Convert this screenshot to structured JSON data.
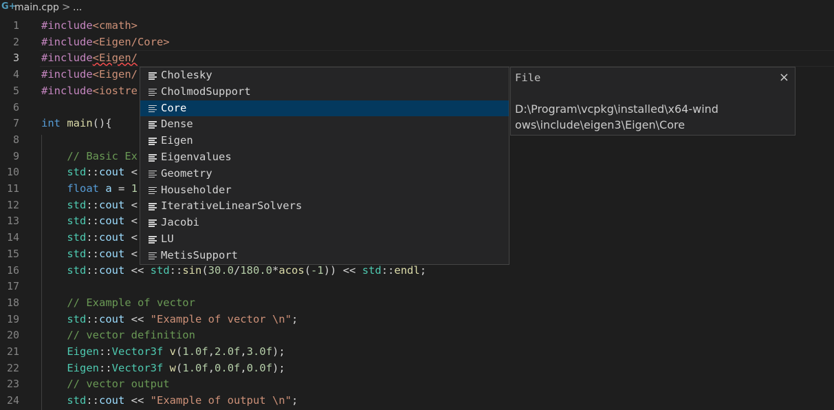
{
  "breadcrumb": {
    "file_icon": "G+",
    "file": "main.cpp",
    "separator": ">",
    "ellipsis": "..."
  },
  "editor": {
    "current_line": 3,
    "lines": [
      {
        "n": "1",
        "tokens": [
          [
            "dir",
            "#include"
          ],
          [
            "str",
            "<cmath>"
          ]
        ]
      },
      {
        "n": "2",
        "tokens": [
          [
            "dir",
            "#include"
          ],
          [
            "str",
            "<Eigen/Core>"
          ]
        ]
      },
      {
        "n": "3",
        "tokens": [
          [
            "dir",
            "#include"
          ],
          [
            "str",
            "<Eigen/"
          ]
        ]
      },
      {
        "n": "4",
        "tokens": [
          [
            "dir",
            "#include"
          ],
          [
            "str",
            "<Eigen/"
          ]
        ]
      },
      {
        "n": "5",
        "tokens": [
          [
            "dir",
            "#include"
          ],
          [
            "str",
            "<iostre"
          ]
        ]
      },
      {
        "n": "6",
        "tokens": []
      },
      {
        "n": "7",
        "tokens": [
          [
            "kw",
            "int"
          ],
          [
            "op",
            " "
          ],
          [
            "fn",
            "main"
          ],
          [
            "op",
            "(){"
          ]
        ]
      },
      {
        "n": "8",
        "tokens": []
      },
      {
        "n": "9",
        "tokens": [
          [
            "op",
            "    "
          ],
          [
            "com",
            "// Basic Ex"
          ]
        ]
      },
      {
        "n": "10",
        "tokens": [
          [
            "op",
            "    "
          ],
          [
            "ns",
            "std"
          ],
          [
            "op",
            "::"
          ],
          [
            "var",
            "cout"
          ],
          [
            "op",
            " <"
          ]
        ]
      },
      {
        "n": "11",
        "tokens": [
          [
            "op",
            "    "
          ],
          [
            "kw",
            "float"
          ],
          [
            "op",
            " "
          ],
          [
            "var",
            "a"
          ],
          [
            "op",
            " = "
          ],
          [
            "num",
            "1"
          ]
        ]
      },
      {
        "n": "12",
        "tokens": [
          [
            "op",
            "    "
          ],
          [
            "ns",
            "std"
          ],
          [
            "op",
            "::"
          ],
          [
            "var",
            "cout"
          ],
          [
            "op",
            " <"
          ]
        ]
      },
      {
        "n": "13",
        "tokens": [
          [
            "op",
            "    "
          ],
          [
            "ns",
            "std"
          ],
          [
            "op",
            "::"
          ],
          [
            "var",
            "cout"
          ],
          [
            "op",
            " <"
          ]
        ]
      },
      {
        "n": "14",
        "tokens": [
          [
            "op",
            "    "
          ],
          [
            "ns",
            "std"
          ],
          [
            "op",
            "::"
          ],
          [
            "var",
            "cout"
          ],
          [
            "op",
            " <"
          ]
        ]
      },
      {
        "n": "15",
        "tokens": [
          [
            "op",
            "    "
          ],
          [
            "ns",
            "std"
          ],
          [
            "op",
            "::"
          ],
          [
            "var",
            "cout"
          ],
          [
            "op",
            " <"
          ]
        ]
      },
      {
        "n": "16",
        "tokens": [
          [
            "op",
            "    "
          ],
          [
            "ns",
            "std"
          ],
          [
            "op",
            "::"
          ],
          [
            "var",
            "cout"
          ],
          [
            "op",
            " << "
          ],
          [
            "ns",
            "std"
          ],
          [
            "op",
            "::"
          ],
          [
            "fn",
            "sin"
          ],
          [
            "op",
            "("
          ],
          [
            "num",
            "30.0"
          ],
          [
            "op",
            "/"
          ],
          [
            "num",
            "180.0"
          ],
          [
            "op",
            "*"
          ],
          [
            "fn",
            "acos"
          ],
          [
            "op",
            "("
          ],
          [
            "num",
            "-1"
          ],
          [
            "op",
            ")) << "
          ],
          [
            "ns",
            "std"
          ],
          [
            "op",
            "::"
          ],
          [
            "fn",
            "endl"
          ],
          [
            "op",
            ";"
          ]
        ]
      },
      {
        "n": "17",
        "tokens": []
      },
      {
        "n": "18",
        "tokens": [
          [
            "op",
            "    "
          ],
          [
            "com",
            "// Example of vector"
          ]
        ]
      },
      {
        "n": "19",
        "tokens": [
          [
            "op",
            "    "
          ],
          [
            "ns",
            "std"
          ],
          [
            "op",
            "::"
          ],
          [
            "var",
            "cout"
          ],
          [
            "op",
            " << "
          ],
          [
            "str",
            "\"Example of vector \\n\""
          ],
          [
            "op",
            ";"
          ]
        ]
      },
      {
        "n": "20",
        "tokens": [
          [
            "op",
            "    "
          ],
          [
            "com",
            "// vector definition"
          ]
        ]
      },
      {
        "n": "21",
        "tokens": [
          [
            "op",
            "    "
          ],
          [
            "ns",
            "Eigen"
          ],
          [
            "op",
            "::"
          ],
          [
            "ns",
            "Vector3f"
          ],
          [
            "op",
            " "
          ],
          [
            "fn",
            "v"
          ],
          [
            "op",
            "("
          ],
          [
            "num",
            "1.0f"
          ],
          [
            "op",
            ","
          ],
          [
            "num",
            "2.0f"
          ],
          [
            "op",
            ","
          ],
          [
            "num",
            "3.0f"
          ],
          [
            "op",
            ");"
          ]
        ]
      },
      {
        "n": "22",
        "tokens": [
          [
            "op",
            "    "
          ],
          [
            "ns",
            "Eigen"
          ],
          [
            "op",
            "::"
          ],
          [
            "ns",
            "Vector3f"
          ],
          [
            "op",
            " "
          ],
          [
            "fn",
            "w"
          ],
          [
            "op",
            "("
          ],
          [
            "num",
            "1.0f"
          ],
          [
            "op",
            ","
          ],
          [
            "num",
            "0.0f"
          ],
          [
            "op",
            ","
          ],
          [
            "num",
            "0.0f"
          ],
          [
            "op",
            ");"
          ]
        ]
      },
      {
        "n": "23",
        "tokens": [
          [
            "op",
            "    "
          ],
          [
            "com",
            "// vector output"
          ]
        ]
      },
      {
        "n": "24",
        "tokens": [
          [
            "op",
            "    "
          ],
          [
            "ns",
            "std"
          ],
          [
            "op",
            "::"
          ],
          [
            "var",
            "cout"
          ],
          [
            "op",
            " << "
          ],
          [
            "str",
            "\"Example of output \\n\""
          ],
          [
            "op",
            ";"
          ]
        ]
      }
    ]
  },
  "suggest": {
    "item_icon": "text-lines-icon",
    "selected_index": 2,
    "items": [
      "Cholesky",
      "CholmodSupport",
      "Core",
      "Dense",
      "Eigen",
      "Eigenvalues",
      "Geometry",
      "Householder",
      "IterativeLinearSolvers",
      "Jacobi",
      "LU",
      "MetisSupport"
    ]
  },
  "details": {
    "title": "File",
    "close": "×",
    "path": "D:\\Program\\vcpkg\\installed\\x64-windows\\include\\eigen3\\Eigen\\Core"
  },
  "colors": {
    "background": "#1e1e1e",
    "directive": "#c586c0",
    "string": "#ce9178",
    "keyword": "#569cd6",
    "function": "#dcdcaa",
    "type": "#4ec9b0",
    "variable": "#9cdcfe",
    "number": "#b5cea8",
    "comment": "#6a9955",
    "selection": "#04395e"
  }
}
